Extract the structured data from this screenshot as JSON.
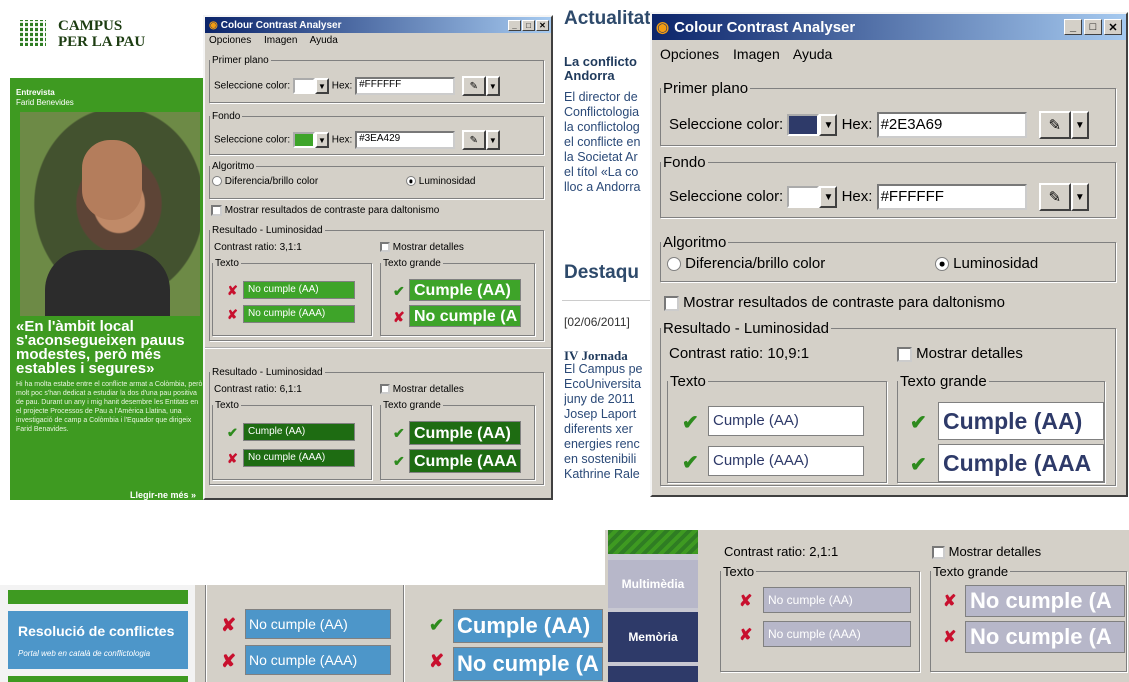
{
  "site": {
    "logo_line1": "CAMPUS",
    "logo_line2": "PER LA PAU",
    "interview_label": "Entrevista",
    "interview_name": "Farid Benevides",
    "quote": "«En l'àmbit local s'aconsegueixen pauus modestes, però més estables i segures»",
    "body": "Hi ha molta estabe entre el conflicte armat a Colòmbia, però molt poc s'han dedicat a estudiar la dos d'una pau positiva de pau. Durant un any i mig hanit desembre les Entitats en el projecte Processos de Pau a l'Amèrica Llatina, una investigació de camp a Colòmbia i l'Equador que dirigeix Farid Benavides.",
    "read_more": "Llegir-ne més »"
  },
  "news": {
    "section1": "Actualitat",
    "title1": "La conflicto Andorra",
    "body1": [
      "El director de",
      "Conflictologia",
      "la conflictolog",
      "el conflicte en",
      "la Societat Ar",
      "el títol «La co",
      "lloc a Andorra"
    ],
    "section2": "Destaqu",
    "date": "[02/06/2011]",
    "title2": "IV Jornada",
    "body2": [
      "El Campus pe",
      "EcoUniversita",
      "juny de 2011",
      "Josep Laport",
      "diferents xer",
      "energies renc",
      "en sostenibili",
      "Kathrine Rale"
    ]
  },
  "small_dialog": {
    "title": "Colour Contrast Analyser",
    "menu": [
      "Opciones",
      "Imagen",
      "Ayuda"
    ],
    "fg_legend": "Primer plano",
    "bg_legend": "Fondo",
    "select_label": "Seleccione color:",
    "hex_label": "Hex:",
    "fg_hex": "#FFFFFF",
    "bg_hex": "#3EA429",
    "fg_color": "#ffffff",
    "bg_color": "#3ea429",
    "algo_legend": "Algoritmo",
    "algo_opt1": "Diferencia/brillo color",
    "algo_opt2": "Luminosidad",
    "daltonism": "Mostrar resultados de contraste para daltonismo",
    "result_legend": "Resultado - Luminosidad",
    "ratio1": "Contrast ratio: 3,1:1",
    "details": "Mostrar detalles",
    "text_legend": "Texto",
    "large_legend": "Texto grande",
    "r1_aa": "No cumple (AA)",
    "r1_aaa": "No cumple (AAA)",
    "r1_large_aa": "Cumple (AA)",
    "r1_large_aaa": "No cumple (A",
    "ratio2": "Contrast ratio: 6,1:1",
    "r2_aa": "Cumple (AA)",
    "r2_aaa": "No cumple (AAA)",
    "r2_large_aa": "Cumple (AA)",
    "r2_large_aaa": "Cumple (AAA"
  },
  "big_dialog": {
    "title": "Colour Contrast Analyser",
    "menu": [
      "Opciones",
      "Imagen",
      "Ayuda"
    ],
    "fg_legend": "Primer plano",
    "bg_legend": "Fondo",
    "select_label": "Seleccione color:",
    "hex_label": "Hex:",
    "fg_hex": "#2E3A69",
    "bg_hex": "#FFFFFF",
    "fg_color": "#2e3a69",
    "bg_color": "#ffffff",
    "algo_legend": "Algoritmo",
    "algo_opt1": "Diferencia/brillo color",
    "algo_opt2": "Luminosidad",
    "daltonism": "Mostrar resultados de contraste para daltonismo",
    "result_legend": "Resultado - Luminosidad",
    "ratio": "Contrast ratio: 10,9:1",
    "details": "Mostrar detalles",
    "text_legend": "Texto",
    "large_legend": "Texto grande",
    "aa": "Cumple (AA)",
    "aaa": "Cumple (AAA)",
    "large_aa": "Cumple (AA)",
    "large_aaa": "Cumple (AAA"
  },
  "bottom_left": {
    "card_title": "Resolució de conflictes",
    "card_sub": "Portal web en català de conflictologia"
  },
  "bottom_mid": {
    "aa": "No cumple (AA)",
    "aaa": "No cumple (AAA)",
    "large_aa": "Cumple (AA)",
    "large_aaa": "No cumple (A"
  },
  "bottom_right": {
    "nav1": "Multimèdia",
    "nav2": "Memòria",
    "ratio": "Contrast ratio: 2,1:1",
    "details": "Mostrar detalles",
    "text_legend": "Texto",
    "large_legend": "Texto grande",
    "aa": "No cumple (AA)",
    "aaa": "No cumple (AAA)",
    "large_aa": "No cumple (A",
    "large_aaa": "No cumple (A"
  }
}
